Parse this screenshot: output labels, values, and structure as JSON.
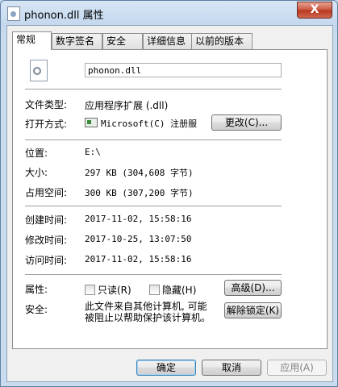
{
  "window": {
    "title": "phonon.dll 属性",
    "close_glyph": "X"
  },
  "tabs": [
    {
      "label": "常规"
    },
    {
      "label": "数字签名"
    },
    {
      "label": "安全"
    },
    {
      "label": "详细信息"
    },
    {
      "label": "以前的版本"
    }
  ],
  "general": {
    "file_name": "phonon.dll",
    "file_type_label": "文件类型:",
    "file_type_value": "应用程序扩展 (.dll)",
    "opens_with_label": "打开方式:",
    "opens_with_value": "Microsoft(C) 注册服",
    "change_button": "更改(C)...",
    "location_label": "位置:",
    "location_value": "E:\\",
    "size_label": "大小:",
    "size_value": "297 KB (304,608 字节)",
    "size_on_disk_label": "占用空间:",
    "size_on_disk_value": "300 KB (307,200 字节)",
    "created_label": "创建时间:",
    "created_value": "2017-11-02, 15:58:16",
    "modified_label": "修改时间:",
    "modified_value": "2017-10-25, 13:07:50",
    "accessed_label": "访问时间:",
    "accessed_value": "2017-11-02, 15:58:16",
    "attributes_label": "属性:",
    "readonly_label": "只读(R)",
    "hidden_label": "隐藏(H)",
    "advanced_button": "高级(D)...",
    "security_label": "安全:",
    "security_text": "此文件来自其他计算机, 可能被阻止以帮助保护该计算机。",
    "unblock_button": "解除锁定(K)"
  },
  "footer": {
    "ok": "确定",
    "cancel": "取消",
    "apply": "应用(A)"
  }
}
